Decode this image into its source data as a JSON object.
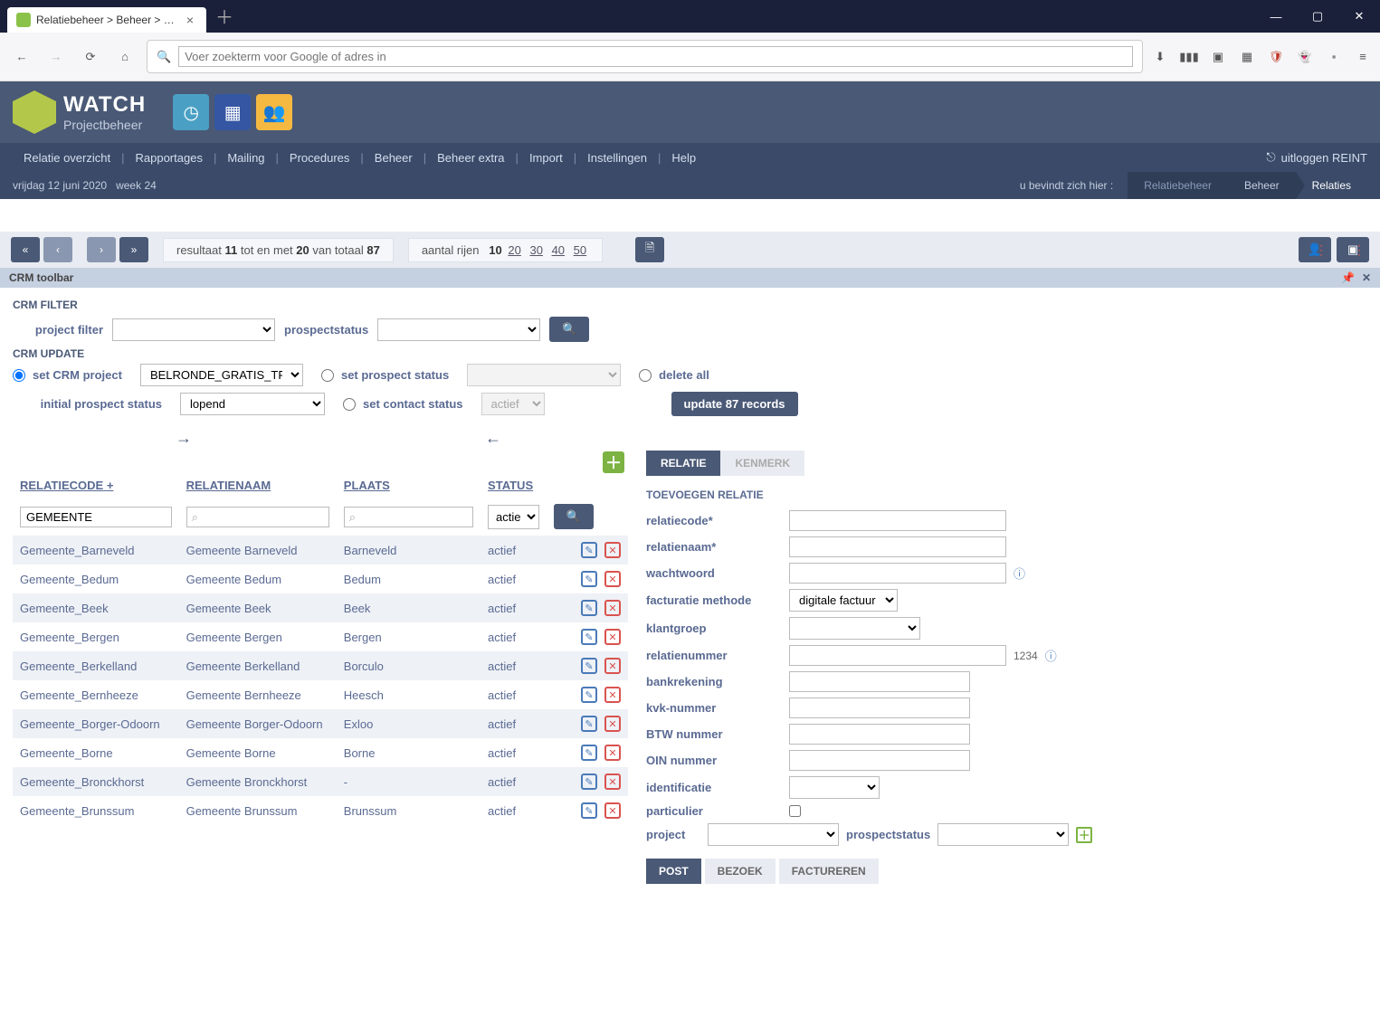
{
  "browser": {
    "tab_title": "Relatiebeheer > Beheer > Relat",
    "address_placeholder": "Voer zoekterm voor Google of adres in"
  },
  "logo": {
    "title": "WATCH",
    "subtitle": "Projectbeheer"
  },
  "nav": {
    "items": [
      "Relatie overzicht",
      "Rapportages",
      "Mailing",
      "Procedures",
      "Beheer",
      "Beheer extra",
      "Import",
      "Instellingen",
      "Help"
    ],
    "logout": "uitloggen REINT"
  },
  "crumb": {
    "date": "vrijdag 12 juni 2020",
    "week": "week 24",
    "you_are_here": "u bevindt zich hier :",
    "path": [
      "Relatiebeheer",
      "Beheer",
      "Relaties"
    ]
  },
  "pager": {
    "result_prefix": "resultaat ",
    "range_from": "11",
    "range_mid": " tot en met ",
    "range_to": "20",
    "total_prefix": " van totaal ",
    "total": "87",
    "rows_label": "aantal rijen",
    "rows_current": "10",
    "rows_options": [
      "20",
      "30",
      "40",
      "50"
    ]
  },
  "crm_toolbar": {
    "title": "CRM toolbar",
    "filter_title": "CRM FILTER",
    "project_filter_label": "project filter",
    "prospectstatus_label": "prospectstatus",
    "update_title": "CRM UPDATE",
    "set_crm_project": "set CRM project",
    "crm_project_value": "BELRONDE_GRATIS_TRIAL",
    "set_prospect_status": "set prospect status",
    "delete_all": "delete all",
    "initial_prospect_status": "initial prospect status",
    "initial_value": "lopend",
    "set_contact_status": "set contact status",
    "contact_value": "actief",
    "update_button": "update 87 records"
  },
  "table": {
    "headers": {
      "code": "RELATIECODE",
      "code_plus": "+",
      "name": "RELATIENAAM",
      "city": "PLAATS",
      "status": "STATUS"
    },
    "filter_code_value": "GEMEENTE",
    "filter_status_value": "actief",
    "rows": [
      {
        "code": "Gemeente_Barneveld",
        "name": "Gemeente Barneveld",
        "city": "Barneveld",
        "status": "actief"
      },
      {
        "code": "Gemeente_Bedum",
        "name": "Gemeente Bedum",
        "city": "Bedum",
        "status": "actief"
      },
      {
        "code": "Gemeente_Beek",
        "name": "Gemeente Beek",
        "city": "Beek",
        "status": "actief"
      },
      {
        "code": "Gemeente_Bergen",
        "name": "Gemeente Bergen",
        "city": "Bergen",
        "status": "actief"
      },
      {
        "code": "Gemeente_Berkelland",
        "name": "Gemeente Berkelland",
        "city": "Borculo",
        "status": "actief"
      },
      {
        "code": "Gemeente_Bernheeze",
        "name": "Gemeente Bernheeze",
        "city": "Heesch",
        "status": "actief"
      },
      {
        "code": "Gemeente_Borger-Odoorn",
        "name": "Gemeente Borger-Odoorn",
        "city": "Exloo",
        "status": "actief"
      },
      {
        "code": "Gemeente_Borne",
        "name": "Gemeente Borne",
        "city": "Borne",
        "status": "actief"
      },
      {
        "code": "Gemeente_Bronckhorst",
        "name": "Gemeente Bronckhorst",
        "city": "-",
        "status": "actief"
      },
      {
        "code": "Gemeente_Brunssum",
        "name": "Gemeente Brunssum",
        "city": "Brunssum",
        "status": "actief"
      }
    ]
  },
  "form": {
    "tabs": {
      "relatie": "RELATIE",
      "kenmerk": "KENMERK"
    },
    "title": "TOEVOEGEN RELATIE",
    "fields": {
      "relatiecode": "relatiecode*",
      "relatienaam": "relatienaam*",
      "wachtwoord": "wachtwoord",
      "facturatie_methode": "facturatie methode",
      "facturatie_value": "digitale factuur",
      "klantgroep": "klantgroep",
      "relatienummer": "relatienummer",
      "relatienummer_hint": "1234",
      "bankrekening": "bankrekening",
      "kvk": "kvk-nummer",
      "btw": "BTW nummer",
      "oin": "OIN nummer",
      "identificatie": "identificatie",
      "particulier": "particulier",
      "project": "project",
      "prospectstatus": "prospectstatus"
    },
    "actions": {
      "post": "POST",
      "bezoek": "BEZOEK",
      "factureren": "FACTUREREN"
    }
  }
}
